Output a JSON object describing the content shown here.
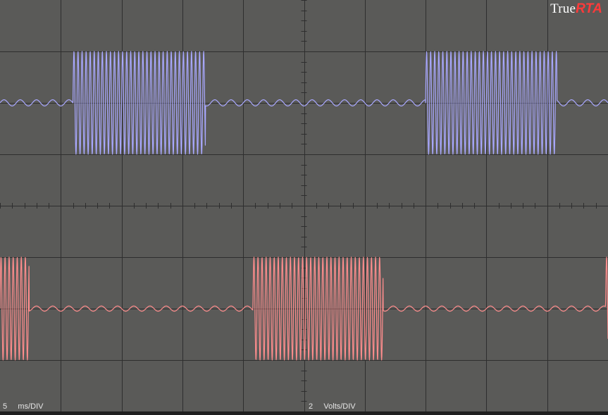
{
  "brand": {
    "word": "True",
    "accent": "RTA",
    "accent_color": "#ff3a3a"
  },
  "readouts": {
    "time_value": "5",
    "time_unit": "ms/DIV",
    "volt_value": "2",
    "volt_unit": "Volts/DIV"
  },
  "colors": {
    "background": "#5a5a58",
    "grid": "#2e2e2e",
    "channel_1": "#a9a8ff",
    "channel_2": "#ff8d8d"
  },
  "chart_data": {
    "type": "line",
    "title": "",
    "grid": true,
    "x_divisions": 10,
    "y_divisions": 8,
    "time_per_div_ms": 5,
    "volts_per_div": 2,
    "xlim_ms": [
      0,
      50
    ],
    "series": [
      {
        "channel": 1,
        "color": "#a9a8ff",
        "baseline_div": 2.0,
        "burst_amplitude_div": 1.0,
        "burst_frequency_hz": 3000,
        "ripple_amplitude_div": 0.06,
        "ripple_frequency_hz": 750,
        "bursts_ms": [
          [
            6.0,
            16.9
          ],
          [
            35.0,
            45.8
          ]
        ]
      },
      {
        "channel": 2,
        "color": "#ff8d8d",
        "baseline_div": -2.0,
        "burst_amplitude_div": 1.0,
        "burst_frequency_hz": 3000,
        "ripple_amplitude_div": 0.05,
        "ripple_frequency_hz": 750,
        "bursts_ms": [
          [
            0.0,
            2.4
          ],
          [
            20.8,
            31.5
          ],
          [
            49.8,
            50.0
          ]
        ]
      }
    ]
  }
}
